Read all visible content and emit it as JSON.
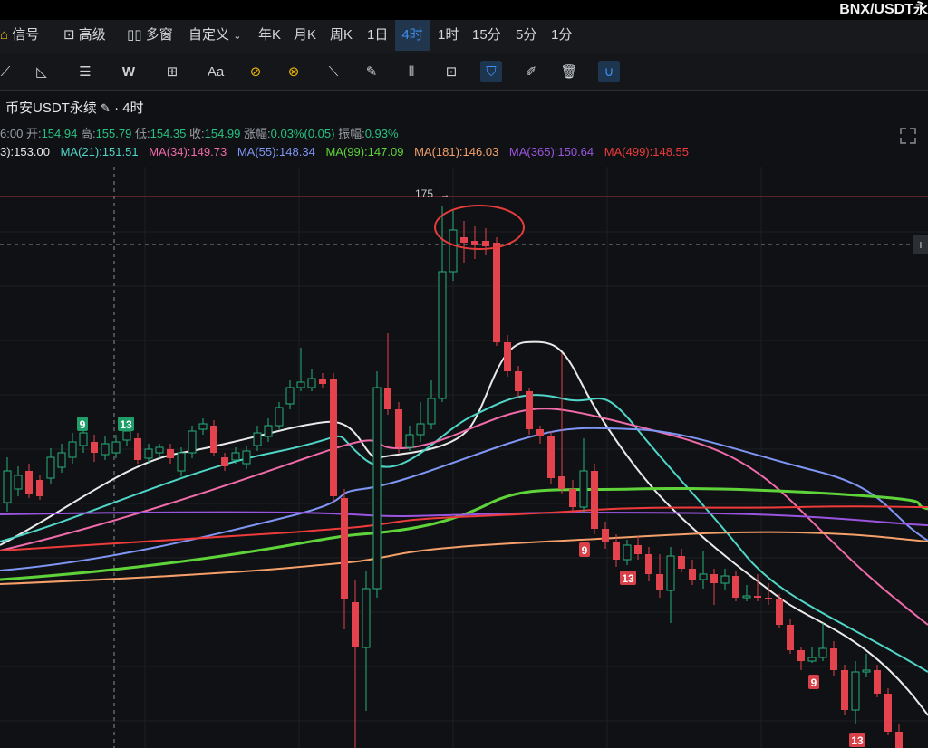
{
  "window": {
    "pair_title": "BNX/USDT永"
  },
  "timeframes": [
    {
      "label": "信号",
      "icon": "signal-icon"
    },
    {
      "label": "高级",
      "icon": "chart-icon"
    },
    {
      "label": "多窗",
      "icon": "multi-window-icon"
    },
    {
      "label": "自定义",
      "icon": "chevron-down-icon"
    },
    {
      "label": "年K"
    },
    {
      "label": "月K"
    },
    {
      "label": "周K"
    },
    {
      "label": "1日"
    },
    {
      "label": "4时",
      "active": true
    },
    {
      "label": "1时"
    },
    {
      "label": "15分"
    },
    {
      "label": "5分"
    },
    {
      "label": "1分"
    }
  ],
  "drawing_tools": [
    "cursor-icon",
    "trendline-icon",
    "hlines-icon",
    "wave-icon",
    "measure-icon",
    "text-icon",
    "brush-icon",
    "fib-icon",
    "ruler-icon",
    "pencil-icon",
    "barpattern-icon",
    "lock-icon",
    "bookmark-icon",
    "note-icon",
    "trash-icon",
    "magnet-icon"
  ],
  "symbol": {
    "exchange_label": "币安USDT永续",
    "interval": "· 4时"
  },
  "ohlc": {
    "time": "6:00",
    "open_label": "开:",
    "open": "154.94",
    "high_label": "高:",
    "high": "155.79",
    "low_label": "低:",
    "low": "154.35",
    "close_label": "收:",
    "close": "154.99",
    "change_label": "涨幅:",
    "change": "0.03%(0.05)",
    "amp_label": "振幅:",
    "amp": "0.93%"
  },
  "ma_legend": [
    {
      "text": "3):153.00",
      "color": "#e9e9e9"
    },
    {
      "text": "MA(21):151.51",
      "color": "#4fd6c8"
    },
    {
      "text": "MA(34):149.73",
      "color": "#f06ba9"
    },
    {
      "text": "MA(55):148.34",
      "color": "#7f96f5"
    },
    {
      "text": "MA(99):147.09",
      "color": "#5fd33a"
    },
    {
      "text": "MA(181):146.03",
      "color": "#f5a06a"
    },
    {
      "text": "MA(365):150.64",
      "color": "#9a55e0"
    },
    {
      "text": "MA(499):148.55",
      "color": "#ee3b3b"
    }
  ],
  "price_labels": {
    "high_marker": "175"
  },
  "sequence_markers": [
    {
      "text": "9",
      "kind": "up"
    },
    {
      "text": "13",
      "kind": "up"
    },
    {
      "text": "9",
      "kind": "down"
    },
    {
      "text": "13",
      "kind": "down"
    },
    {
      "text": "9",
      "kind": "down"
    },
    {
      "text": "13",
      "kind": "down"
    }
  ],
  "colors": {
    "up": "#26b07a",
    "down": "#e2434c",
    "background": "#101114",
    "accent": "#3d8ff0",
    "annotation": "#e53c3c"
  },
  "plus_button": "+"
}
